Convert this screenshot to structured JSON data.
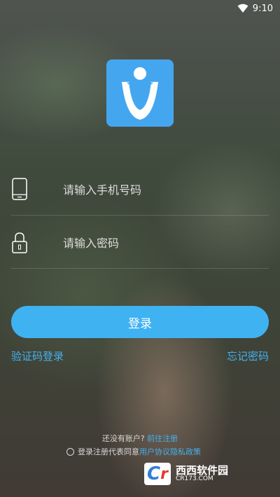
{
  "status_bar": {
    "time": "9:10",
    "wifi_icon": "wifi-icon"
  },
  "logo": {
    "icon": "app-logo-icon",
    "color": "#45a6f0"
  },
  "phone_field": {
    "icon": "phone-icon",
    "placeholder": "请输入手机号码",
    "value": ""
  },
  "password_field": {
    "icon": "lock-icon",
    "placeholder": "请输入密码",
    "value": ""
  },
  "login_button": {
    "label": "登录",
    "color": "#3fb2f2"
  },
  "links": {
    "sms_login": "验证码登录",
    "forgot_password": "忘记密码"
  },
  "footer": {
    "no_account": "还没有账户?",
    "register": "前往注册",
    "agree_prefix": "登录注册代表同意",
    "policy": "用户协议隐私政策"
  },
  "watermark": {
    "logo_c": "C",
    "logo_r": "r",
    "brand": "西西软件园",
    "domain": "CR173.COM"
  },
  "accent_color": "#45b0ef"
}
